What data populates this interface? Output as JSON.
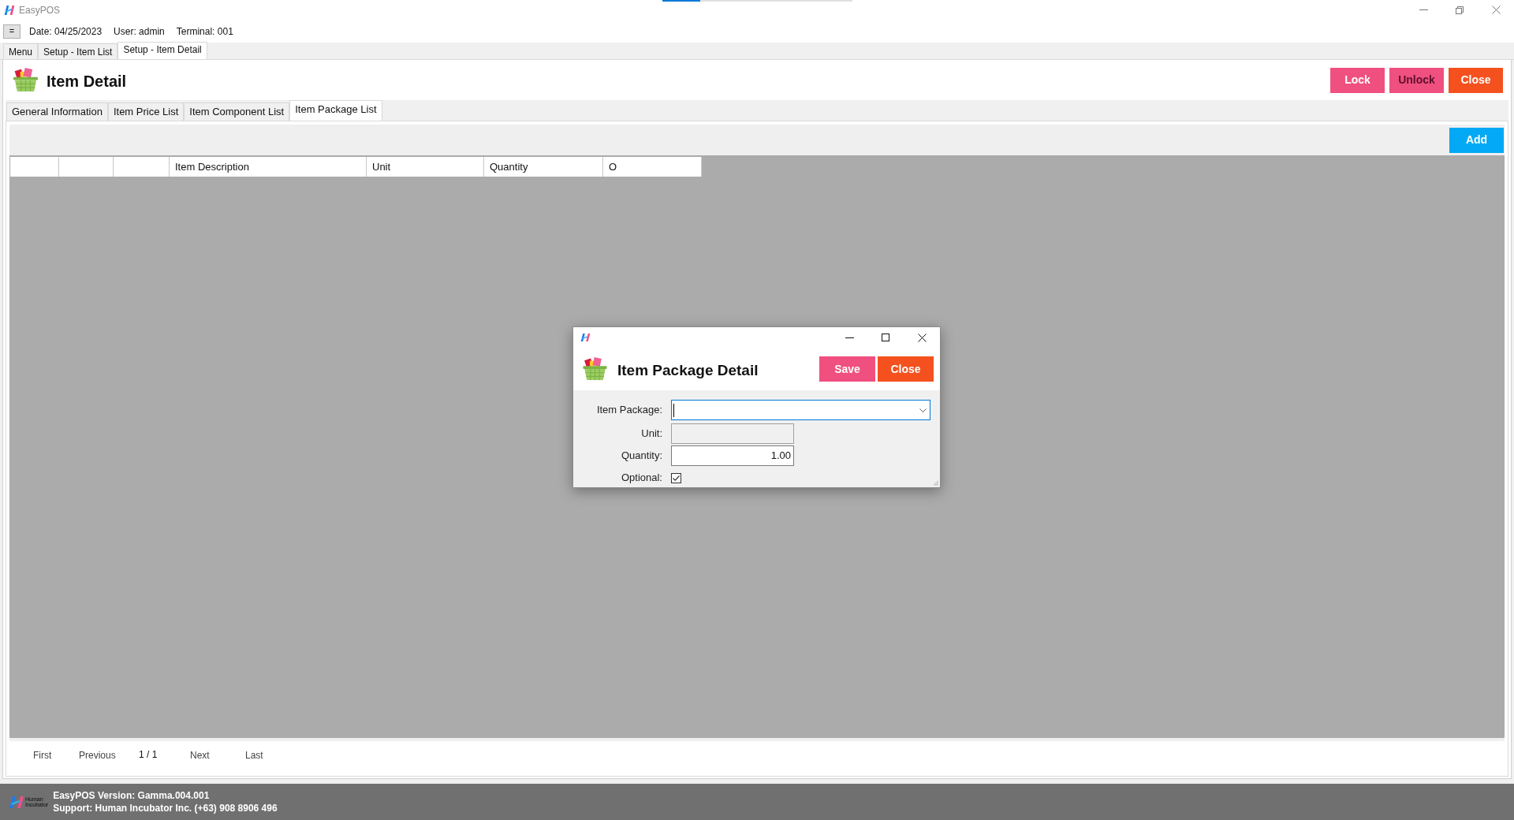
{
  "window": {
    "title": "EasyPOS",
    "progress": {
      "level": 0.2
    }
  },
  "info_bar": {
    "menu_button": "=",
    "date": "Date: 04/25/2023",
    "user": "User: admin",
    "terminal": "Terminal: 001"
  },
  "doc_tabs": [
    {
      "label": "Menu",
      "selected": false
    },
    {
      "label": "Setup - Item List",
      "selected": false
    },
    {
      "label": "Setup - Item Detail",
      "selected": true
    }
  ],
  "page": {
    "title": "Item Detail",
    "buttons": [
      {
        "label": "Lock",
        "color": "#f0507f",
        "disabled": false
      },
      {
        "label": "Unlock",
        "color": "#f0507f",
        "disabled": true
      },
      {
        "label": "Close",
        "color": "#f4511e",
        "disabled": false
      }
    ]
  },
  "detail_tabs": [
    {
      "label": "General Information",
      "selected": false
    },
    {
      "label": "Item Price List",
      "selected": false
    },
    {
      "label": "Item Component List",
      "selected": false
    },
    {
      "label": "Item Package List",
      "selected": true
    }
  ],
  "toolbar": {
    "add_button": "Add"
  },
  "table": {
    "columns": [
      {
        "kind": "blank"
      },
      {
        "kind": "blank"
      },
      {
        "kind": "blank"
      },
      {
        "kind": "text",
        "label": "Item Description"
      },
      {
        "kind": "text",
        "label": "Unit"
      },
      {
        "kind": "text",
        "label": "Quantity"
      },
      {
        "kind": "text",
        "label": "O"
      }
    ]
  },
  "pager": {
    "first": "First",
    "previous": "Previous",
    "page": "1 / 1",
    "next": "Next",
    "last": "Last"
  },
  "status_bar": {
    "logo_lines": [
      "Human",
      "Incubator"
    ],
    "version": "EasyPOS Version: Gamma.004.001",
    "support": "Support: Human Incubator Inc. (+63) 908 8906 496"
  },
  "dialog": {
    "title": "Item Package Detail",
    "buttons": [
      {
        "label": "Save",
        "color": "#f0507f"
      },
      {
        "label": "Close",
        "color": "#f4511e"
      }
    ],
    "fields": [
      {
        "kind": "combo",
        "label": "Item Package:",
        "focused": true
      },
      {
        "kind": "text",
        "label": "Unit:",
        "disabled": true,
        "focused": false
      },
      {
        "kind": "text",
        "label": "Quantity:",
        "value": "1.00",
        "disabled": false,
        "focused": false
      },
      {
        "kind": "checkbox",
        "label": "Optional:",
        "checked": true
      }
    ]
  }
}
